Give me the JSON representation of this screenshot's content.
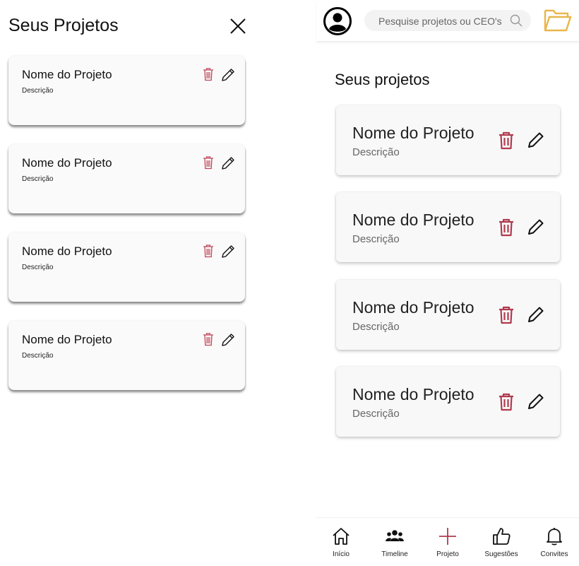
{
  "left_panel": {
    "title": "Seus Projetos",
    "close_icon": "close-icon",
    "projects": [
      {
        "name": "Nome do Projeto",
        "description": "Descrição"
      },
      {
        "name": "Nome do Projeto",
        "description": "Descrição"
      },
      {
        "name": "Nome do Projeto",
        "description": "Descrição"
      },
      {
        "name": "Nome do Projeto",
        "description": "Descrição"
      }
    ]
  },
  "right_panel": {
    "search": {
      "placeholder": "Pesquise projetos ou CEO's"
    },
    "title": "Seus projetos",
    "projects": [
      {
        "name": "Nome do Projeto",
        "description": "Descrição"
      },
      {
        "name": "Nome do Projeto",
        "description": "Descrição"
      },
      {
        "name": "Nome do Projeto",
        "description": "Descrição"
      },
      {
        "name": "Nome do Projeto",
        "description": "Descrição"
      }
    ],
    "bottom_nav": [
      {
        "label": "Início",
        "icon": "home-icon"
      },
      {
        "label": "Timeline",
        "icon": "people-icon"
      },
      {
        "label": "Projeto",
        "icon": "plus-icon"
      },
      {
        "label": "Sugestões",
        "icon": "thumbs-up-icon"
      },
      {
        "label": "Convites",
        "icon": "bell-icon"
      }
    ]
  },
  "colors": {
    "delete": "#b03a4e",
    "folder": "#e8b64a",
    "accent_plus": "#b03a4e"
  }
}
